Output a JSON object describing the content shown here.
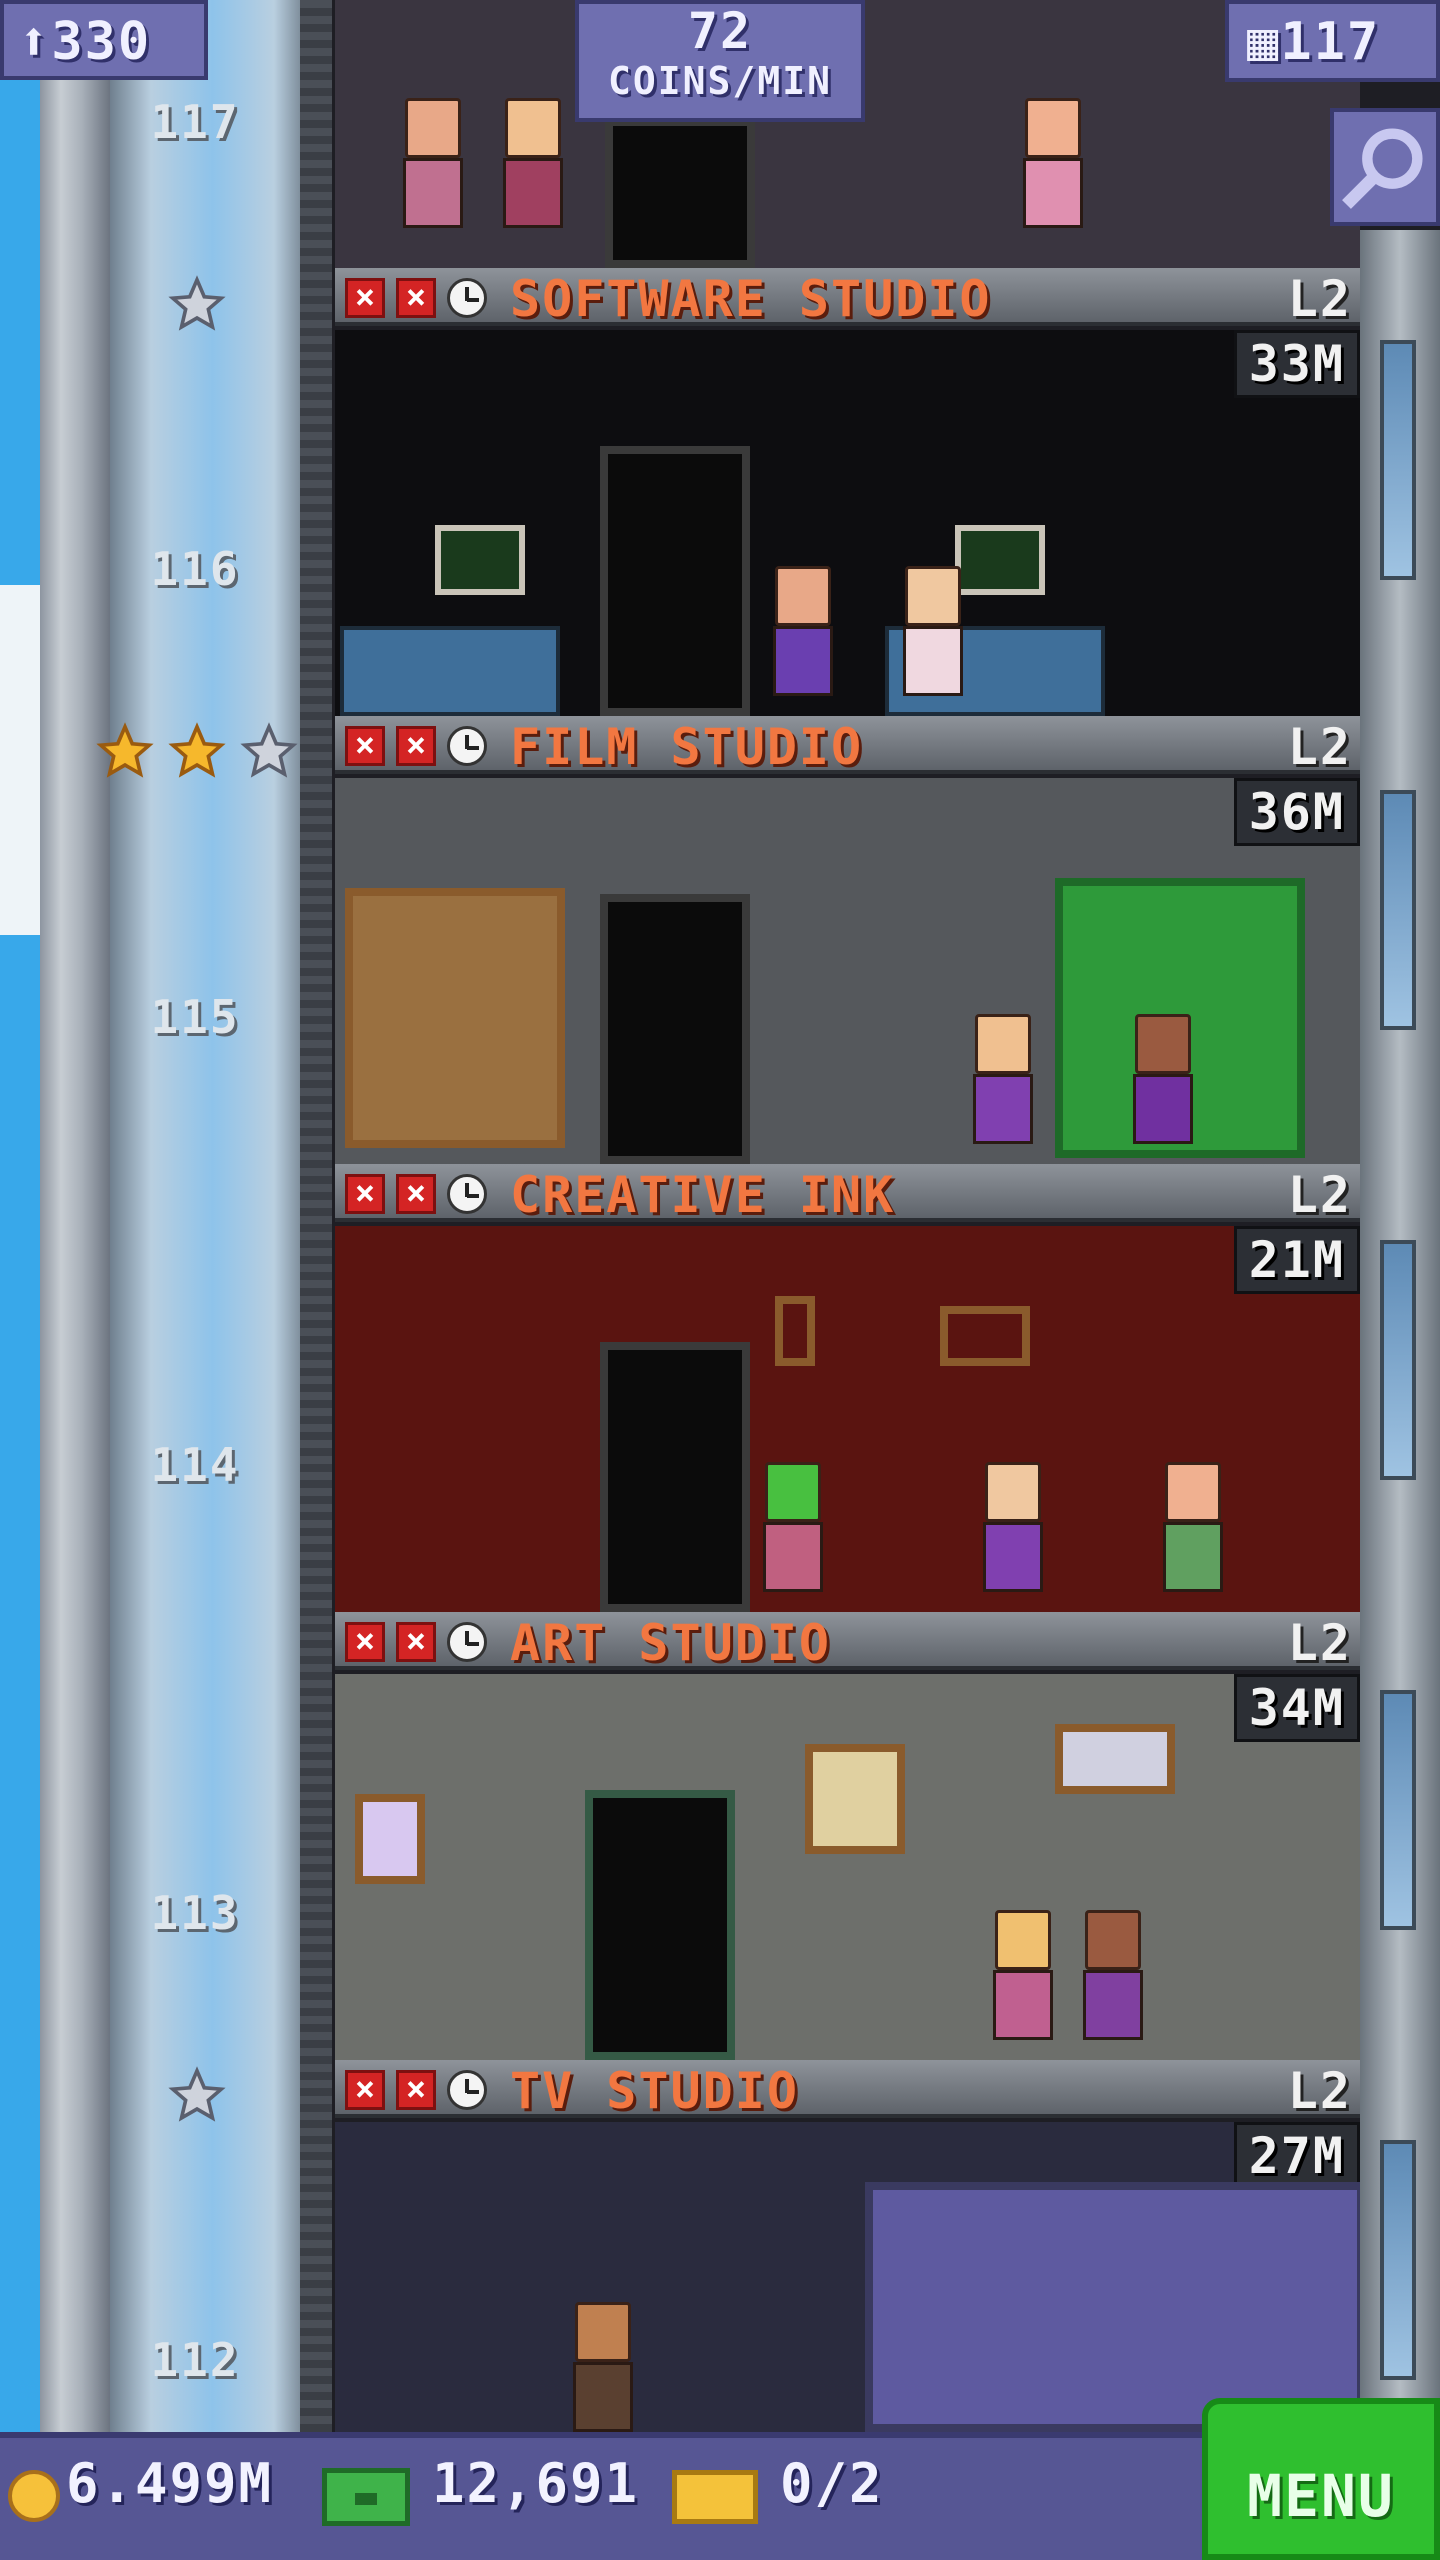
{
  "hud": {
    "population": "330",
    "coins_rate_value": "72",
    "coins_rate_unit": "COINS/MIN",
    "floor_count": "117"
  },
  "elevator": {
    "floor_numbers": [
      "117",
      "116",
      "115",
      "114",
      "113",
      "112"
    ]
  },
  "floors": [
    {
      "name": "SOFTWARE STUDIO",
      "level": "L2",
      "stock": "33M",
      "theme": "#0d0d10",
      "accent": "#4a6f8f"
    },
    {
      "name": "FILM STUDIO",
      "level": "L2",
      "stock": "36M",
      "theme": "#55585c",
      "accent": "#7a5b33"
    },
    {
      "name": "CREATIVE INK",
      "level": "L2",
      "stock": "21M",
      "theme": "#5a1410",
      "accent": "#a83226"
    },
    {
      "name": "ART STUDIO",
      "level": "L2",
      "stock": "34M",
      "theme": "#6d6f6b",
      "accent": "#8a5b2c"
    },
    {
      "name": "TV STUDIO",
      "level": "L2",
      "stock": "27M",
      "theme": "#2a2b3e",
      "accent": "#5e5aa0"
    }
  ],
  "bottom": {
    "coins": "6.499M",
    "bux": "12,691",
    "tickets": "0/2",
    "menu_label": "MENU"
  },
  "colors": {
    "hud": "#6f6fb0",
    "floor_name": "#f27741",
    "menu": "#2fbf2f"
  }
}
